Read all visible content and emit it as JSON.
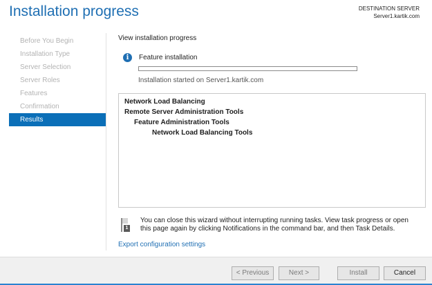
{
  "header": {
    "title": "Installation progress",
    "destination_label": "DESTINATION SERVER",
    "destination_server": "Server1.kartik.com"
  },
  "sidebar": {
    "items": [
      {
        "label": "Before You Begin",
        "active": false
      },
      {
        "label": "Installation Type",
        "active": false
      },
      {
        "label": "Server Selection",
        "active": false
      },
      {
        "label": "Server Roles",
        "active": false
      },
      {
        "label": "Features",
        "active": false
      },
      {
        "label": "Confirmation",
        "active": false
      },
      {
        "label": "Results",
        "active": true
      }
    ]
  },
  "main": {
    "section_label": "View installation progress",
    "status_icon": "info-icon",
    "status_title": "Feature installation",
    "progress_fraction": 0.0,
    "status_detail": "Installation started on Server1.kartik.com",
    "features": [
      {
        "label": "Network Load Balancing",
        "level": 0
      },
      {
        "label": "Remote Server Administration Tools",
        "level": 1
      },
      {
        "label": "Feature Administration Tools",
        "level": 2
      },
      {
        "label": "Network Load Balancing Tools",
        "level": 3
      }
    ],
    "note": "You can close this wizard without interrupting running tasks. View task progress or open this page again by clicking Notifications in the command bar, and then Task Details.",
    "note_icon": "notification-flag-icon",
    "note_badge": "1",
    "export_link": "Export configuration settings"
  },
  "footer": {
    "previous_label": "< Previous",
    "next_label": "Next >",
    "install_label": "Install",
    "cancel_label": "Cancel"
  },
  "colors": {
    "accent": "#1f6fb3",
    "sidebar_active": "#0b6fb8",
    "progress_fill": "#06b025"
  }
}
